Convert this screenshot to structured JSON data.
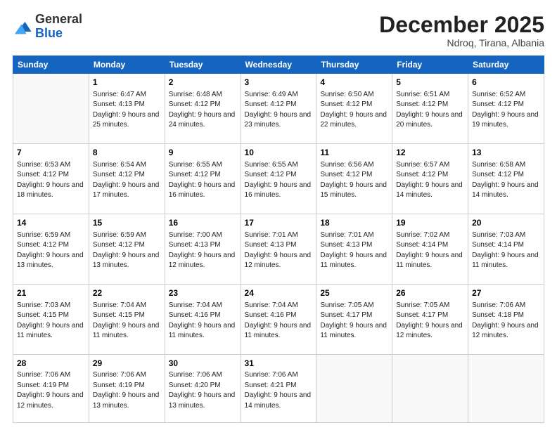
{
  "logo": {
    "general": "General",
    "blue": "Blue"
  },
  "title": "December 2025",
  "subtitle": "Ndroq, Tirana, Albania",
  "weekdays": [
    "Sunday",
    "Monday",
    "Tuesday",
    "Wednesday",
    "Thursday",
    "Friday",
    "Saturday"
  ],
  "weeks": [
    [
      {
        "day": "",
        "sunrise": "",
        "sunset": "",
        "daylight": ""
      },
      {
        "day": "1",
        "sunrise": "Sunrise: 6:47 AM",
        "sunset": "Sunset: 4:13 PM",
        "daylight": "Daylight: 9 hours and 25 minutes."
      },
      {
        "day": "2",
        "sunrise": "Sunrise: 6:48 AM",
        "sunset": "Sunset: 4:12 PM",
        "daylight": "Daylight: 9 hours and 24 minutes."
      },
      {
        "day": "3",
        "sunrise": "Sunrise: 6:49 AM",
        "sunset": "Sunset: 4:12 PM",
        "daylight": "Daylight: 9 hours and 23 minutes."
      },
      {
        "day": "4",
        "sunrise": "Sunrise: 6:50 AM",
        "sunset": "Sunset: 4:12 PM",
        "daylight": "Daylight: 9 hours and 22 minutes."
      },
      {
        "day": "5",
        "sunrise": "Sunrise: 6:51 AM",
        "sunset": "Sunset: 4:12 PM",
        "daylight": "Daylight: 9 hours and 20 minutes."
      },
      {
        "day": "6",
        "sunrise": "Sunrise: 6:52 AM",
        "sunset": "Sunset: 4:12 PM",
        "daylight": "Daylight: 9 hours and 19 minutes."
      }
    ],
    [
      {
        "day": "7",
        "sunrise": "Sunrise: 6:53 AM",
        "sunset": "Sunset: 4:12 PM",
        "daylight": "Daylight: 9 hours and 18 minutes."
      },
      {
        "day": "8",
        "sunrise": "Sunrise: 6:54 AM",
        "sunset": "Sunset: 4:12 PM",
        "daylight": "Daylight: 9 hours and 17 minutes."
      },
      {
        "day": "9",
        "sunrise": "Sunrise: 6:55 AM",
        "sunset": "Sunset: 4:12 PM",
        "daylight": "Daylight: 9 hours and 16 minutes."
      },
      {
        "day": "10",
        "sunrise": "Sunrise: 6:55 AM",
        "sunset": "Sunset: 4:12 PM",
        "daylight": "Daylight: 9 hours and 16 minutes."
      },
      {
        "day": "11",
        "sunrise": "Sunrise: 6:56 AM",
        "sunset": "Sunset: 4:12 PM",
        "daylight": "Daylight: 9 hours and 15 minutes."
      },
      {
        "day": "12",
        "sunrise": "Sunrise: 6:57 AM",
        "sunset": "Sunset: 4:12 PM",
        "daylight": "Daylight: 9 hours and 14 minutes."
      },
      {
        "day": "13",
        "sunrise": "Sunrise: 6:58 AM",
        "sunset": "Sunset: 4:12 PM",
        "daylight": "Daylight: 9 hours and 14 minutes."
      }
    ],
    [
      {
        "day": "14",
        "sunrise": "Sunrise: 6:59 AM",
        "sunset": "Sunset: 4:12 PM",
        "daylight": "Daylight: 9 hours and 13 minutes."
      },
      {
        "day": "15",
        "sunrise": "Sunrise: 6:59 AM",
        "sunset": "Sunset: 4:12 PM",
        "daylight": "Daylight: 9 hours and 13 minutes."
      },
      {
        "day": "16",
        "sunrise": "Sunrise: 7:00 AM",
        "sunset": "Sunset: 4:13 PM",
        "daylight": "Daylight: 9 hours and 12 minutes."
      },
      {
        "day": "17",
        "sunrise": "Sunrise: 7:01 AM",
        "sunset": "Sunset: 4:13 PM",
        "daylight": "Daylight: 9 hours and 12 minutes."
      },
      {
        "day": "18",
        "sunrise": "Sunrise: 7:01 AM",
        "sunset": "Sunset: 4:13 PM",
        "daylight": "Daylight: 9 hours and 11 minutes."
      },
      {
        "day": "19",
        "sunrise": "Sunrise: 7:02 AM",
        "sunset": "Sunset: 4:14 PM",
        "daylight": "Daylight: 9 hours and 11 minutes."
      },
      {
        "day": "20",
        "sunrise": "Sunrise: 7:03 AM",
        "sunset": "Sunset: 4:14 PM",
        "daylight": "Daylight: 9 hours and 11 minutes."
      }
    ],
    [
      {
        "day": "21",
        "sunrise": "Sunrise: 7:03 AM",
        "sunset": "Sunset: 4:15 PM",
        "daylight": "Daylight: 9 hours and 11 minutes."
      },
      {
        "day": "22",
        "sunrise": "Sunrise: 7:04 AM",
        "sunset": "Sunset: 4:15 PM",
        "daylight": "Daylight: 9 hours and 11 minutes."
      },
      {
        "day": "23",
        "sunrise": "Sunrise: 7:04 AM",
        "sunset": "Sunset: 4:16 PM",
        "daylight": "Daylight: 9 hours and 11 minutes."
      },
      {
        "day": "24",
        "sunrise": "Sunrise: 7:04 AM",
        "sunset": "Sunset: 4:16 PM",
        "daylight": "Daylight: 9 hours and 11 minutes."
      },
      {
        "day": "25",
        "sunrise": "Sunrise: 7:05 AM",
        "sunset": "Sunset: 4:17 PM",
        "daylight": "Daylight: 9 hours and 11 minutes."
      },
      {
        "day": "26",
        "sunrise": "Sunrise: 7:05 AM",
        "sunset": "Sunset: 4:17 PM",
        "daylight": "Daylight: 9 hours and 12 minutes."
      },
      {
        "day": "27",
        "sunrise": "Sunrise: 7:06 AM",
        "sunset": "Sunset: 4:18 PM",
        "daylight": "Daylight: 9 hours and 12 minutes."
      }
    ],
    [
      {
        "day": "28",
        "sunrise": "Sunrise: 7:06 AM",
        "sunset": "Sunset: 4:19 PM",
        "daylight": "Daylight: 9 hours and 12 minutes."
      },
      {
        "day": "29",
        "sunrise": "Sunrise: 7:06 AM",
        "sunset": "Sunset: 4:19 PM",
        "daylight": "Daylight: 9 hours and 13 minutes."
      },
      {
        "day": "30",
        "sunrise": "Sunrise: 7:06 AM",
        "sunset": "Sunset: 4:20 PM",
        "daylight": "Daylight: 9 hours and 13 minutes."
      },
      {
        "day": "31",
        "sunrise": "Sunrise: 7:06 AM",
        "sunset": "Sunset: 4:21 PM",
        "daylight": "Daylight: 9 hours and 14 minutes."
      },
      {
        "day": "",
        "sunrise": "",
        "sunset": "",
        "daylight": ""
      },
      {
        "day": "",
        "sunrise": "",
        "sunset": "",
        "daylight": ""
      },
      {
        "day": "",
        "sunrise": "",
        "sunset": "",
        "daylight": ""
      }
    ]
  ]
}
